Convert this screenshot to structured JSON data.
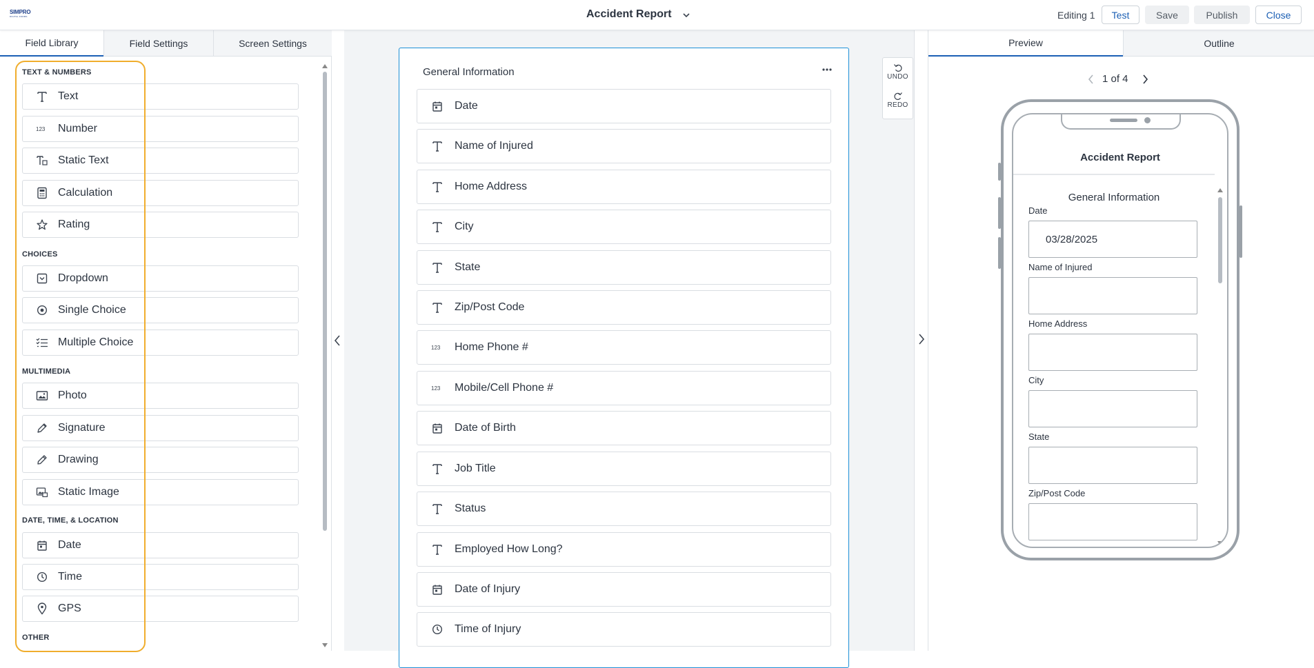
{
  "header": {
    "logo_line1": "SIMPRO",
    "logo_line2": "DIGITAL FORMS",
    "title": "Accident Report",
    "editing": "Editing 1",
    "buttons": {
      "test": "Test",
      "save": "Save",
      "publish": "Publish",
      "close": "Close"
    }
  },
  "left_panel": {
    "tabs": [
      "Field Library",
      "Field Settings",
      "Screen Settings"
    ],
    "categories": {
      "text_numbers": "TEXT & NUMBERS",
      "choices": "CHOICES",
      "multimedia": "MULTIMEDIA",
      "datetime": "DATE, TIME, & LOCATION",
      "other": "OTHER"
    },
    "fields": [
      {
        "label": "Text",
        "icon": "text-icon"
      },
      {
        "label": "Number",
        "icon": "number-icon"
      },
      {
        "label": "Static Text",
        "icon": "static-text-icon"
      },
      {
        "label": "Calculation",
        "icon": "calculator-icon"
      },
      {
        "label": "Rating",
        "icon": "star-icon"
      },
      {
        "label": "Dropdown",
        "icon": "dropdown-icon"
      },
      {
        "label": "Single Choice",
        "icon": "radio-icon"
      },
      {
        "label": "Multiple Choice",
        "icon": "checklist-icon"
      },
      {
        "label": "Photo",
        "icon": "photo-icon"
      },
      {
        "label": "Signature",
        "icon": "pen-icon"
      },
      {
        "label": "Drawing",
        "icon": "pencil-icon"
      },
      {
        "label": "Static Image",
        "icon": "image-icon"
      },
      {
        "label": "Date",
        "icon": "calendar-icon"
      },
      {
        "label": "Time",
        "icon": "clock-icon"
      },
      {
        "label": "GPS",
        "icon": "location-pin-icon"
      }
    ]
  },
  "canvas": {
    "screen_title": "General Information",
    "undo": "UNDO",
    "redo": "REDO",
    "fields": [
      {
        "label": "Date",
        "icon": "calendar-icon"
      },
      {
        "label": "Name of Injured",
        "icon": "text-icon"
      },
      {
        "label": "Home Address",
        "icon": "text-icon"
      },
      {
        "label": "City",
        "icon": "text-icon"
      },
      {
        "label": "State",
        "icon": "text-icon"
      },
      {
        "label": "Zip/Post Code",
        "icon": "text-icon"
      },
      {
        "label": "Home Phone #",
        "icon": "number-icon"
      },
      {
        "label": "Mobile/Cell Phone #",
        "icon": "number-icon"
      },
      {
        "label": "Date of Birth",
        "icon": "calendar-icon"
      },
      {
        "label": "Job Title",
        "icon": "text-icon"
      },
      {
        "label": "Status",
        "icon": "text-icon"
      },
      {
        "label": "Employed How Long?",
        "icon": "text-icon"
      },
      {
        "label": "Date of Injury",
        "icon": "calendar-icon"
      },
      {
        "label": "Time of Injury",
        "icon": "clock-icon"
      }
    ]
  },
  "right_panel": {
    "tabs": [
      "Preview",
      "Outline"
    ],
    "pager": "1 of 4",
    "phone": {
      "title": "Accident Report",
      "section": "General Information",
      "fields": [
        {
          "label": "Date",
          "value": "03/28/2025"
        },
        {
          "label": "Name of Injured",
          "value": ""
        },
        {
          "label": "Home Address",
          "value": ""
        },
        {
          "label": "City",
          "value": ""
        },
        {
          "label": "State",
          "value": ""
        },
        {
          "label": "Zip/Post Code",
          "value": ""
        }
      ]
    }
  },
  "colors": {
    "accent": "#1b5fb4",
    "highlight": "#f0ad2c",
    "screen_border": "#1b8fd6"
  }
}
